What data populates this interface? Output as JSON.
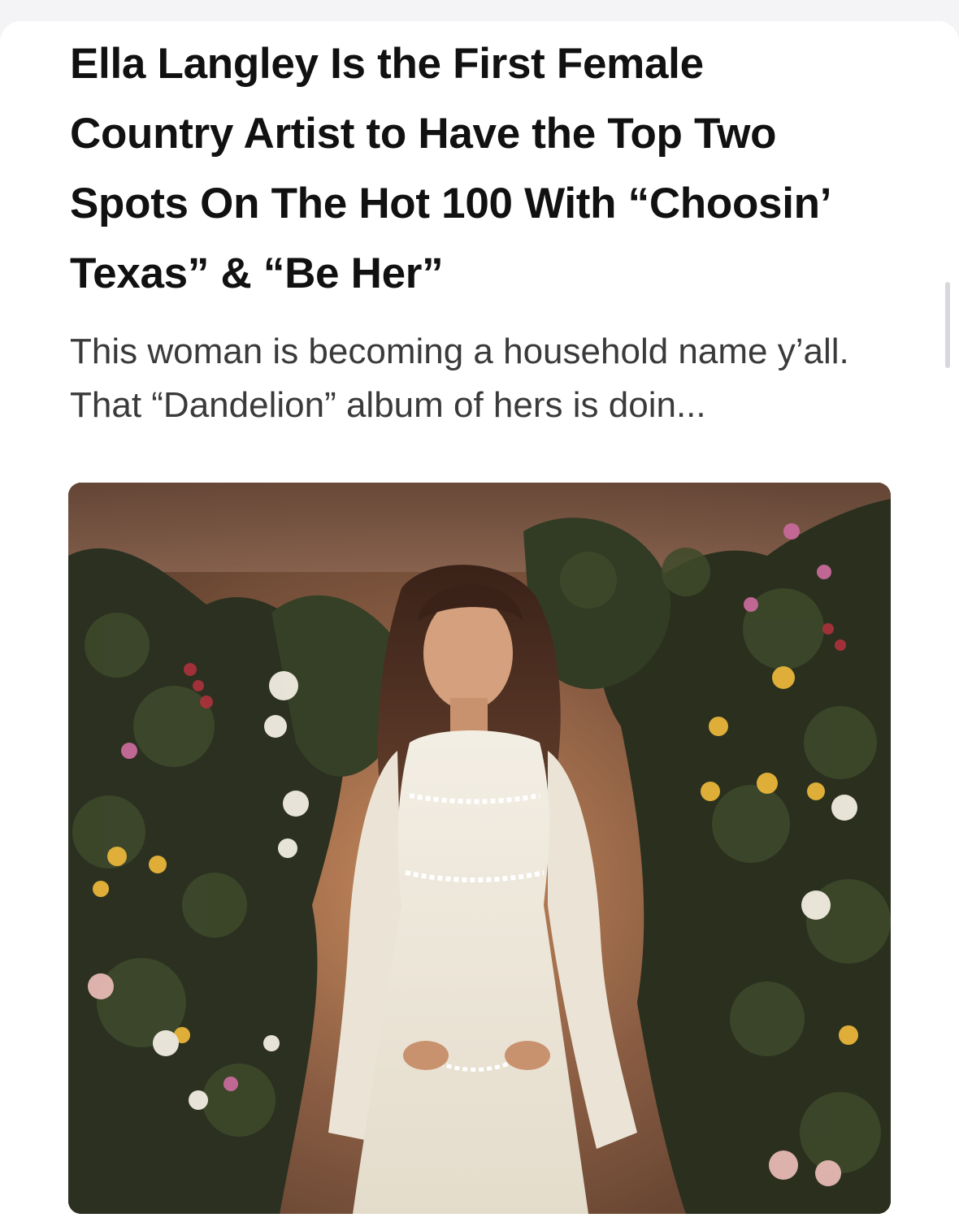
{
  "article": {
    "headline": "Ella Langley Is the First Female Country Artist to Have the Top Two Spots On The Hot 100 With “Choosin’ Texas” & “Be Her”",
    "summary": "This woman is becoming a household name y’all. That “Dandelion” album of hers is doin..."
  },
  "image": {
    "content": "photo-woman-white-dress-flower-wall",
    "colors": {
      "backdrop": "#7a5a46",
      "foliage": "#2d3320",
      "dress": "#efe9dc",
      "hair": "#4a2e20"
    }
  }
}
